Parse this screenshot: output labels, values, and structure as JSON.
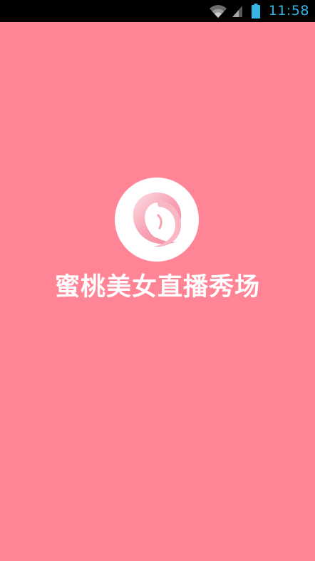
{
  "status_bar": {
    "time": "11:58",
    "icons": [
      "wifi-icon",
      "signal-icon",
      "battery-icon"
    ],
    "colors": {
      "background": "#000000",
      "clock": "#33b5e5"
    }
  },
  "splash": {
    "title": "蜜桃美女直播秀场",
    "logo_icon": "peach-logo-icon",
    "colors": {
      "background": "#ff8496",
      "logo_circle": "#ffffff",
      "logo_mark": "#f7a0b0",
      "title": "#ffffff"
    }
  }
}
